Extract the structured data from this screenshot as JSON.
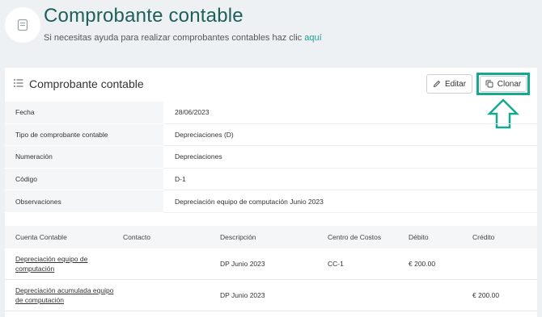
{
  "header": {
    "title": "Comprobante contable",
    "subtitle_text": "Si necesitas ayuda para realizar comprobantes contables haz clic",
    "subtitle_link": "aquí"
  },
  "card": {
    "title": "Comprobante contable",
    "edit_label": "Editar",
    "clone_label": "Clonar"
  },
  "details": [
    {
      "label": "Fecha",
      "value": "28/06/2023"
    },
    {
      "label": "Tipo de comprobante contable",
      "value": "Depreciaciones (D)"
    },
    {
      "label": "Numeración",
      "value": "Depreciaciones"
    },
    {
      "label": "Código",
      "value": "D-1"
    },
    {
      "label": "Observaciones",
      "value": "Depreciación equipo de computación Junio 2023"
    }
  ],
  "table": {
    "columns": [
      "Cuenta Contable",
      "Contacto",
      "Descripción",
      "Centro de Costos",
      "Débito",
      "Crédito"
    ],
    "rows": [
      {
        "cuenta_1": "Depreciación equipo de",
        "cuenta_2": "computación",
        "contacto": "",
        "descripcion": "DP Junio 2023",
        "centro": "CC-1",
        "debito": "€ 200.00",
        "credito": ""
      },
      {
        "cuenta_1": "Depreciación acumulada equipo",
        "cuenta_2": "de computación",
        "contacto": "",
        "descripcion": "DP Junio 2023",
        "centro": "",
        "debito": "",
        "credito": "€ 200.00"
      }
    ]
  },
  "colors": {
    "accent": "#17a98f",
    "title": "#1f5f5a",
    "link": "#1aa38f"
  }
}
